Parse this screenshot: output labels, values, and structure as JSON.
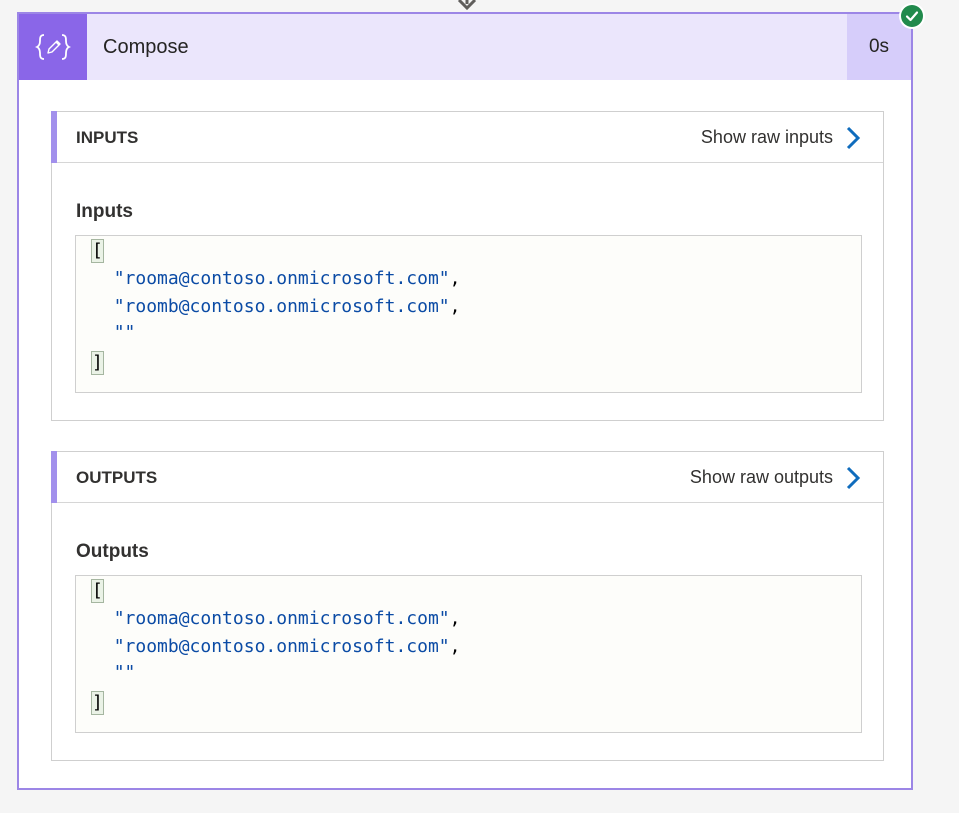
{
  "card": {
    "title": "Compose",
    "duration": "0s",
    "icon": "curly-braces-pen-icon",
    "status_icon": "check-circle-icon",
    "colors": {
      "accent": "#8a66e8",
      "header_bg": "#ebe6fc",
      "border": "#9c86e6",
      "success": "#218a4c",
      "link_chevron": "#0f6cbd",
      "code_string": "#0b4ba5"
    }
  },
  "inputs": {
    "section_title": "INPUTS",
    "show_raw_label": "Show raw inputs",
    "field_label": "Inputs",
    "code": {
      "open": "[",
      "items": [
        "\"rooma@contoso.onmicrosoft.com\"",
        "\"roomb@contoso.onmicrosoft.com\"",
        "\"\""
      ],
      "comma": ",",
      "close": "]"
    }
  },
  "outputs": {
    "section_title": "OUTPUTS",
    "show_raw_label": "Show raw outputs",
    "field_label": "Outputs",
    "code": {
      "open": "[",
      "items": [
        "\"rooma@contoso.onmicrosoft.com\"",
        "\"roomb@contoso.onmicrosoft.com\"",
        "\"\""
      ],
      "comma": ",",
      "close": "]"
    }
  }
}
